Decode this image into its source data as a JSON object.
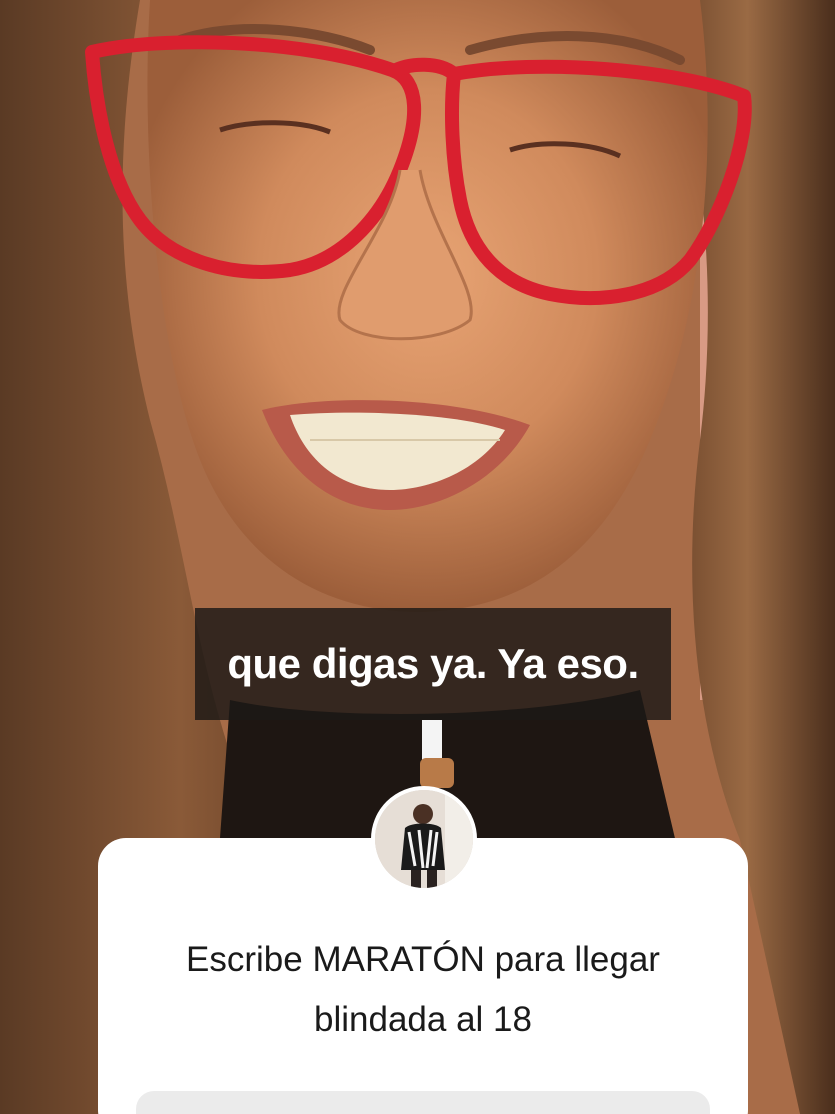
{
  "caption": {
    "text": "que digas ya. Ya eso."
  },
  "question_sticker": {
    "prompt_line1": "Escribe MARATÓN para llegar",
    "prompt_line2": "blindada al 18",
    "answer_placeholder": ""
  },
  "colors": {
    "glasses_red": "#d9202f",
    "card_background": "#ffffff",
    "caption_background": "#1c1816",
    "answer_field": "#ebebeb"
  }
}
